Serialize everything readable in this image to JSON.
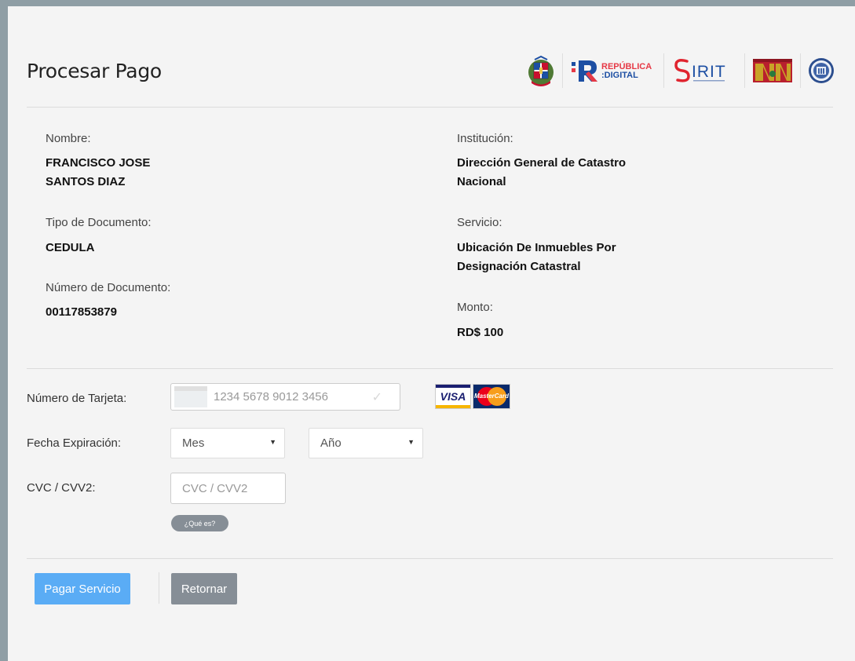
{
  "page": {
    "title": "Procesar Pago"
  },
  "logos": [
    {
      "icon": "dominican-coat-of-arms-icon"
    },
    {
      "icon": "republica-digital-logo",
      "text_top": "REPÚBLICA",
      "text_bottom": ":DIGITAL"
    },
    {
      "icon": "sirit-logo",
      "text": "IRIT"
    },
    {
      "icon": "catastro-logo"
    },
    {
      "icon": "seal-logo"
    }
  ],
  "info": {
    "nombre_label": "Nombre:",
    "nombre_line1": "FRANCISCO JOSE",
    "nombre_line2": "SANTOS DIAZ",
    "tipo_doc_label": "Tipo de Documento:",
    "tipo_doc_value": "CEDULA",
    "num_doc_label": "Número de Documento:",
    "num_doc_value": "00117853879",
    "institucion_label": "Institución:",
    "institucion_line1": "Dirección General de Catastro",
    "institucion_line2": "Nacional",
    "servicio_label": "Servicio:",
    "servicio_line1": "Ubicación De Inmuebles Por",
    "servicio_line2": "Designación Catastral",
    "monto_label": "Monto:",
    "monto_value": "RD$ 100"
  },
  "form": {
    "card_label": "Número de Tarjeta:",
    "card_placeholder": "1234 5678 9012 3456",
    "expiry_label": "Fecha Expiración:",
    "month_value": "Mes",
    "year_value": "Año",
    "cvc_label": "CVC / CVV2:",
    "cvc_placeholder": "CVC / CVV2",
    "help_label": "¿Qué es?",
    "visa_text": "VISA",
    "mastercard_text": "MasterCard"
  },
  "actions": {
    "pay_label": "Pagar Servicio",
    "back_label": "Retornar"
  },
  "colors": {
    "primary": "#5aacf5",
    "secondary": "#868e96",
    "panel": "#f4f4f4",
    "frame": "#8f9ea5",
    "rd_blue": "#1d4fa3",
    "rd_red": "#e63946",
    "sirit_red": "#e0242f"
  }
}
